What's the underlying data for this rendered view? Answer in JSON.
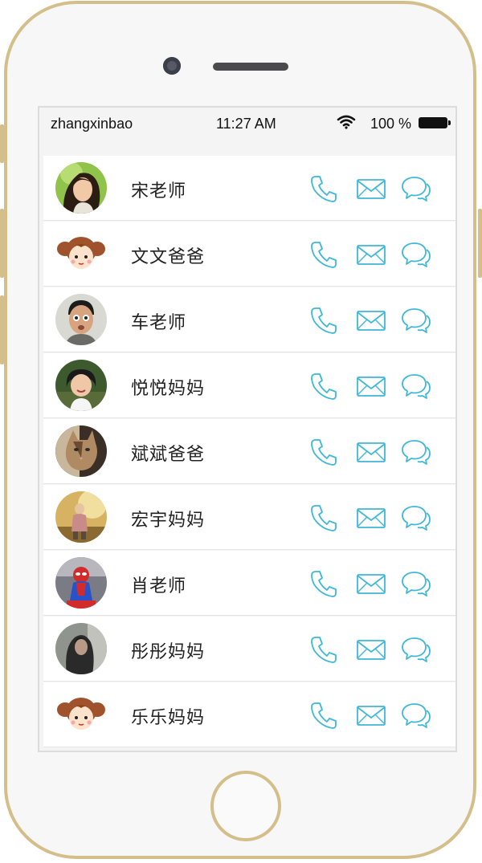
{
  "status_bar": {
    "carrier": "zhangxinbao",
    "time": "11:27 AM",
    "battery": "100 %"
  },
  "accent_color": "#3fb8d8",
  "contacts": [
    {
      "name": "宋老师",
      "avatar": "woman-photo-avatar"
    },
    {
      "name": "文文爸爸",
      "avatar": "cartoon-girl-avatar"
    },
    {
      "name": "车老师",
      "avatar": "man-photo-avatar"
    },
    {
      "name": "悦悦妈妈",
      "avatar": "child-photo-avatar"
    },
    {
      "name": "斌斌爸爸",
      "avatar": "cat-photo-avatar"
    },
    {
      "name": "宏宇妈妈",
      "avatar": "outdoor-photo-avatar"
    },
    {
      "name": "肖老师",
      "avatar": "spiderman-toy-avatar"
    },
    {
      "name": "彤彤妈妈",
      "avatar": "dark-photo-avatar"
    },
    {
      "name": "乐乐妈妈",
      "avatar": "cartoon-girl-avatar"
    }
  ],
  "actions": {
    "call_icon": "phone-icon",
    "mail_icon": "mail-icon",
    "chat_icon": "chat-bubble-icon"
  }
}
